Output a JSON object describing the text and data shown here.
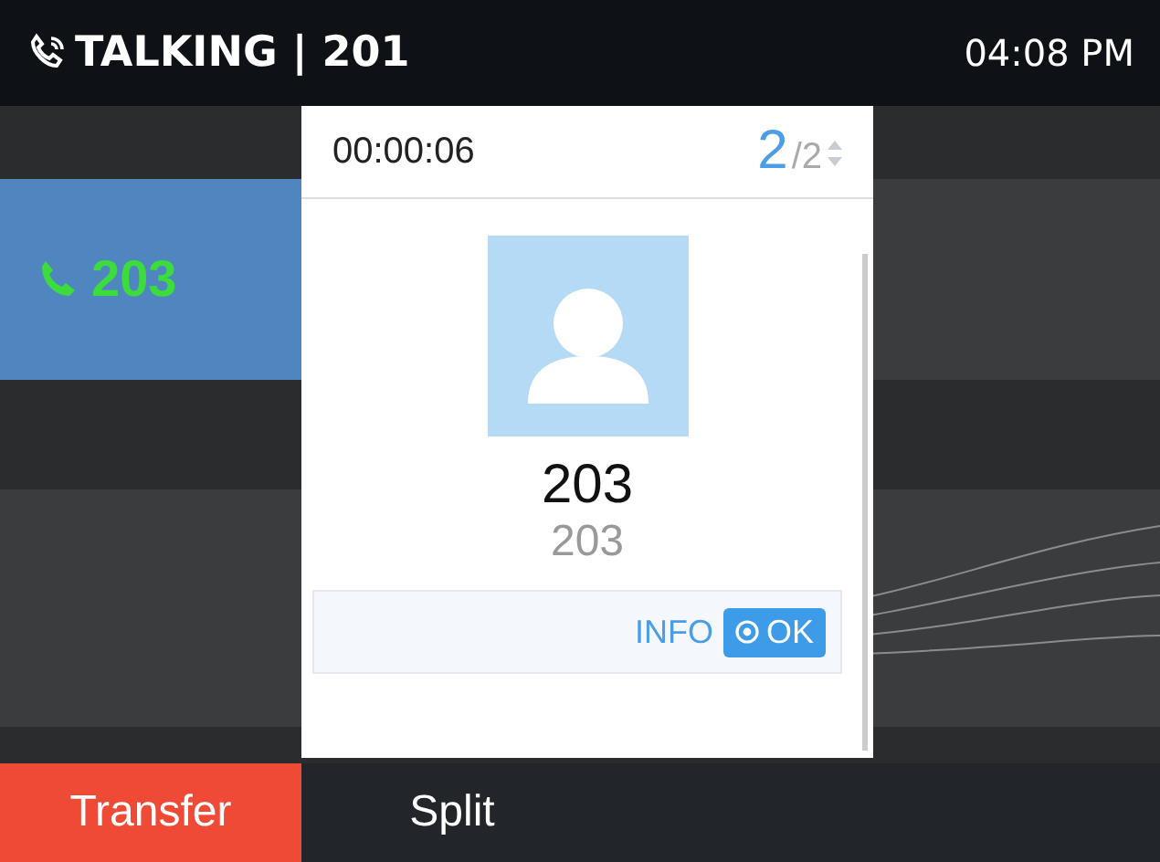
{
  "status_bar": {
    "title": "TALKING | 201",
    "time": "04:08 PM"
  },
  "lines": [
    {
      "label": "203",
      "selected": true
    }
  ],
  "call_popup": {
    "duration": "00:00:06",
    "page": "2",
    "page_total": "/2",
    "name": "203",
    "number": "203",
    "info": "INFO",
    "ok": "OK"
  },
  "softkeys": [
    {
      "label": "Transfer",
      "selected": true
    },
    {
      "label": "Split",
      "selected": false
    }
  ]
}
